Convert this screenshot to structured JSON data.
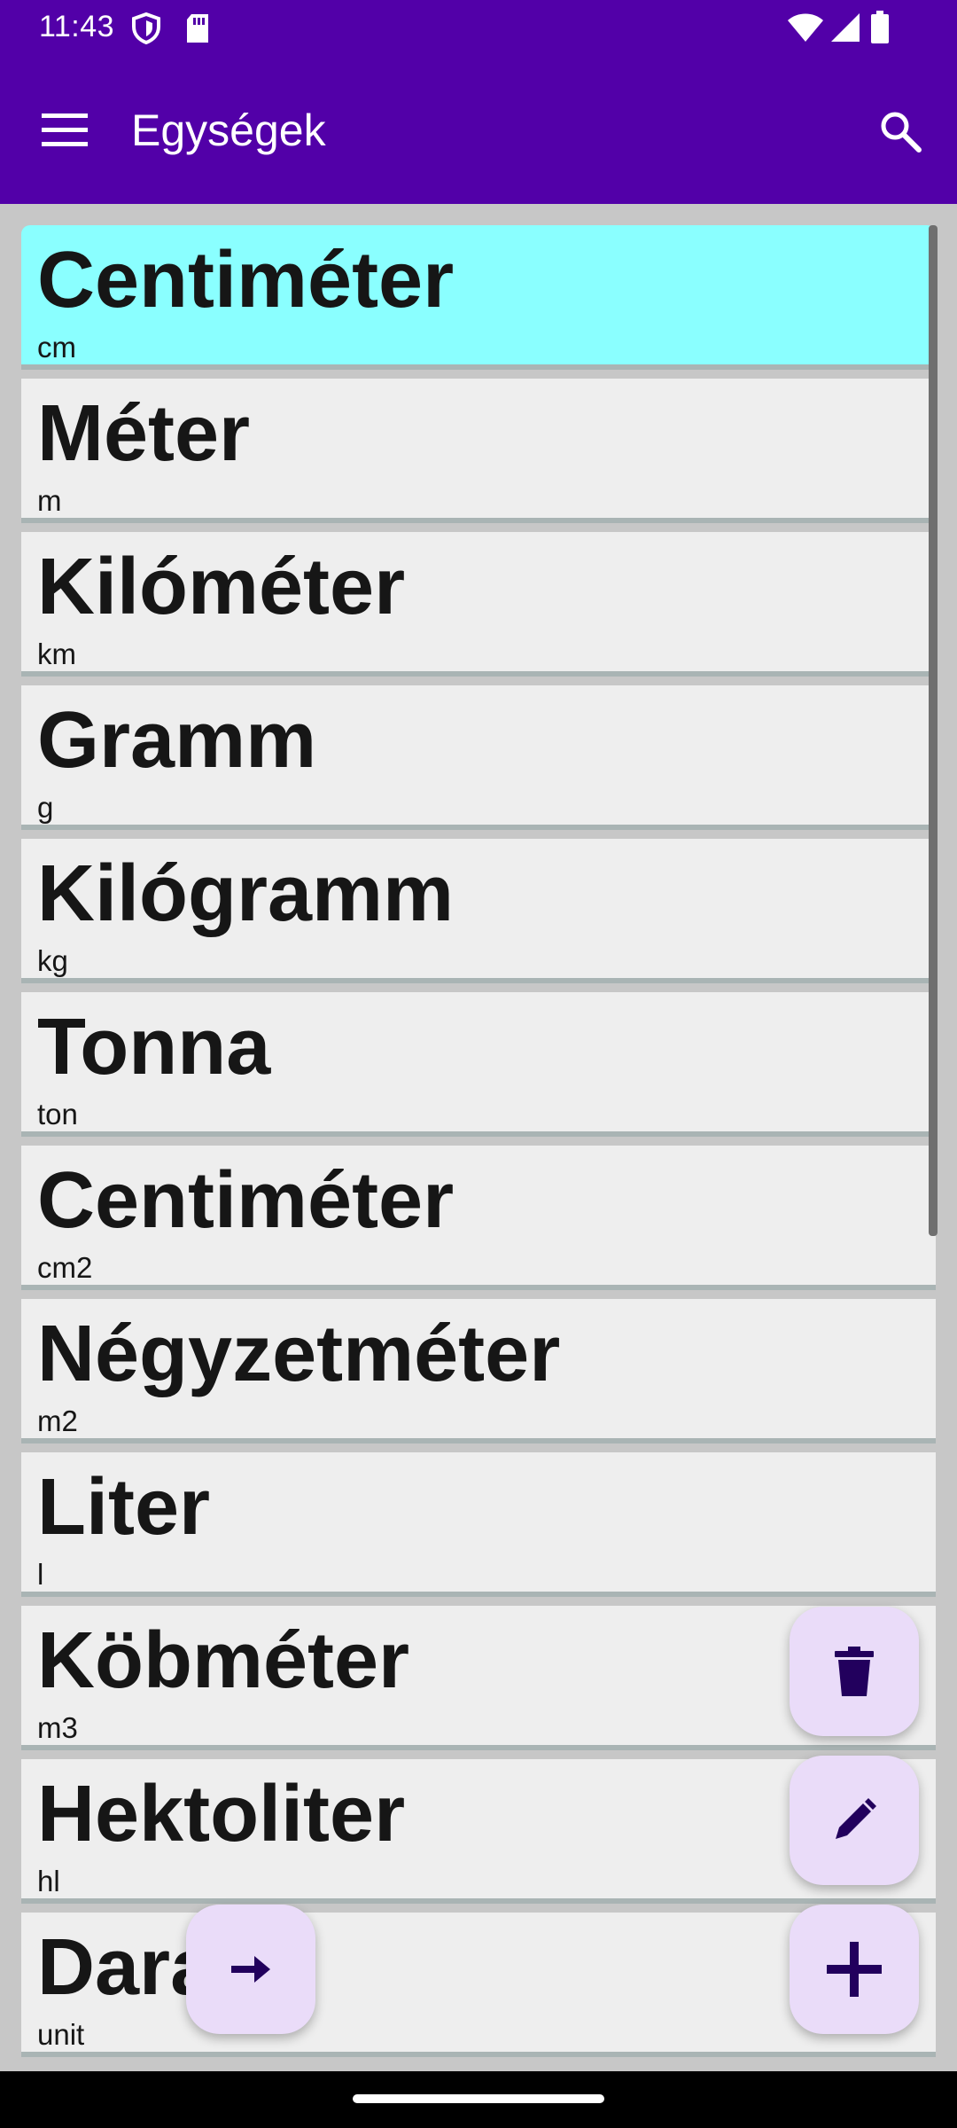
{
  "status_bar": {
    "time": "11:43",
    "icons": [
      "shield-icon",
      "sd-card-icon",
      "wifi-icon",
      "signal-icon",
      "battery-icon"
    ]
  },
  "app_bar": {
    "title": "Egységek",
    "menu_icon": "hamburger-menu-icon",
    "search_icon": "search-icon"
  },
  "units": [
    {
      "name": "Centiméter",
      "abbr": "cm",
      "selected": true
    },
    {
      "name": "Méter",
      "abbr": "m"
    },
    {
      "name": "Kilóméter",
      "abbr": "km"
    },
    {
      "name": "Gramm",
      "abbr": "g"
    },
    {
      "name": "Kilógramm",
      "abbr": "kg"
    },
    {
      "name": "Tonna",
      "abbr": "ton"
    },
    {
      "name": "Centiméter",
      "abbr": "cm2"
    },
    {
      "name": "Négyzetméter",
      "abbr": "m2"
    },
    {
      "name": "Liter",
      "abbr": "l"
    },
    {
      "name": "Köbméter",
      "abbr": "m3"
    },
    {
      "name": "Hektoliter",
      "abbr": "hl"
    },
    {
      "name": "Darab",
      "abbr": "unit"
    }
  ],
  "fabs": {
    "delete_icon": "trash-icon",
    "edit_icon": "pencil-icon",
    "add_icon": "plus-icon",
    "forward_icon": "arrow-right-icon"
  },
  "colors": {
    "primary": "#5200a8",
    "selected_item": "#8affff",
    "item_background": "#eeeeee",
    "fab_background": "#eadcf9",
    "fab_icon": "#22005d"
  }
}
